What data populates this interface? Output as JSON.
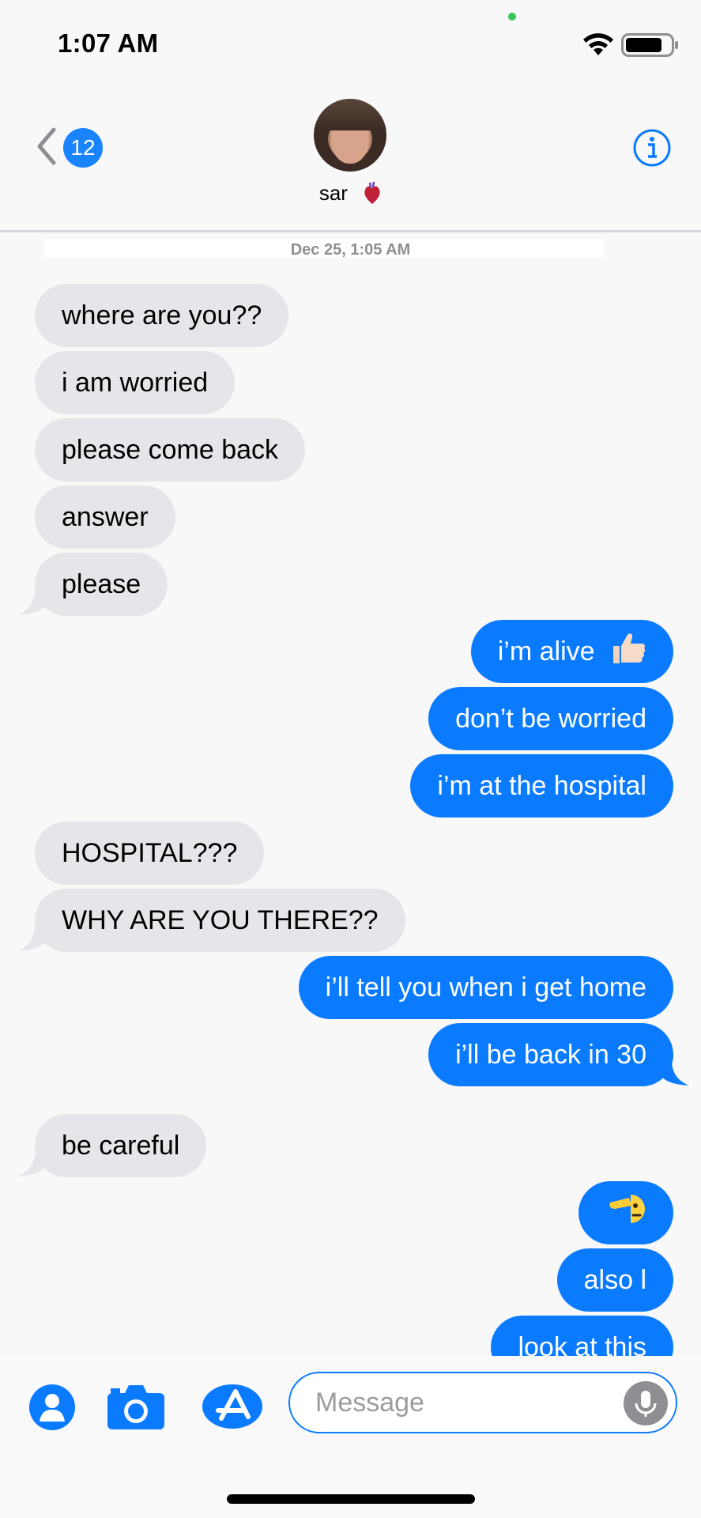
{
  "status_bar": {
    "time": "1:07 AM",
    "icons": [
      "wifi-icon",
      "battery-icon"
    ]
  },
  "header": {
    "back_badge_count": "12",
    "contact_name": "sar",
    "contact_emoji": "anatomical-heart-icon",
    "info_icon": "info-icon"
  },
  "conversation": {
    "timestamp": "Dec 25, 1:05 AM",
    "messages": [
      {
        "dir": "in",
        "text": "where are you??"
      },
      {
        "dir": "in",
        "text": "i am worried"
      },
      {
        "dir": "in",
        "text": "please come back"
      },
      {
        "dir": "in",
        "text": "answer"
      },
      {
        "dir": "in",
        "text": "please"
      },
      {
        "dir": "out",
        "text": "i’m alive",
        "emoji": "thumbs-up-icon"
      },
      {
        "dir": "out",
        "text": "don’t be worried"
      },
      {
        "dir": "out",
        "text": "i’m at the hospital"
      },
      {
        "dir": "in",
        "text": "HOSPITAL???"
      },
      {
        "dir": "in",
        "text": "WHY ARE YOU THERE??"
      },
      {
        "dir": "out",
        "text": "i’ll tell you when i get home"
      },
      {
        "dir": "out",
        "text": "i’ll be back in 30"
      },
      {
        "dir": "in",
        "text": "be careful"
      },
      {
        "dir": "out",
        "text": "",
        "emoji": "saluting-face-icon"
      },
      {
        "dir": "out",
        "text": "also l"
      },
      {
        "dir": "out",
        "text": "look at this"
      }
    ]
  },
  "input": {
    "placeholder": "Message",
    "left_icons": [
      "contact-card-icon",
      "camera-icon",
      "app-store-icon"
    ],
    "right_icon": "microphone-icon"
  },
  "colors": {
    "outgoing_bubble": "#0a7bff",
    "incoming_bubble": "#e6e5ea",
    "accent": "#1a84ff"
  }
}
